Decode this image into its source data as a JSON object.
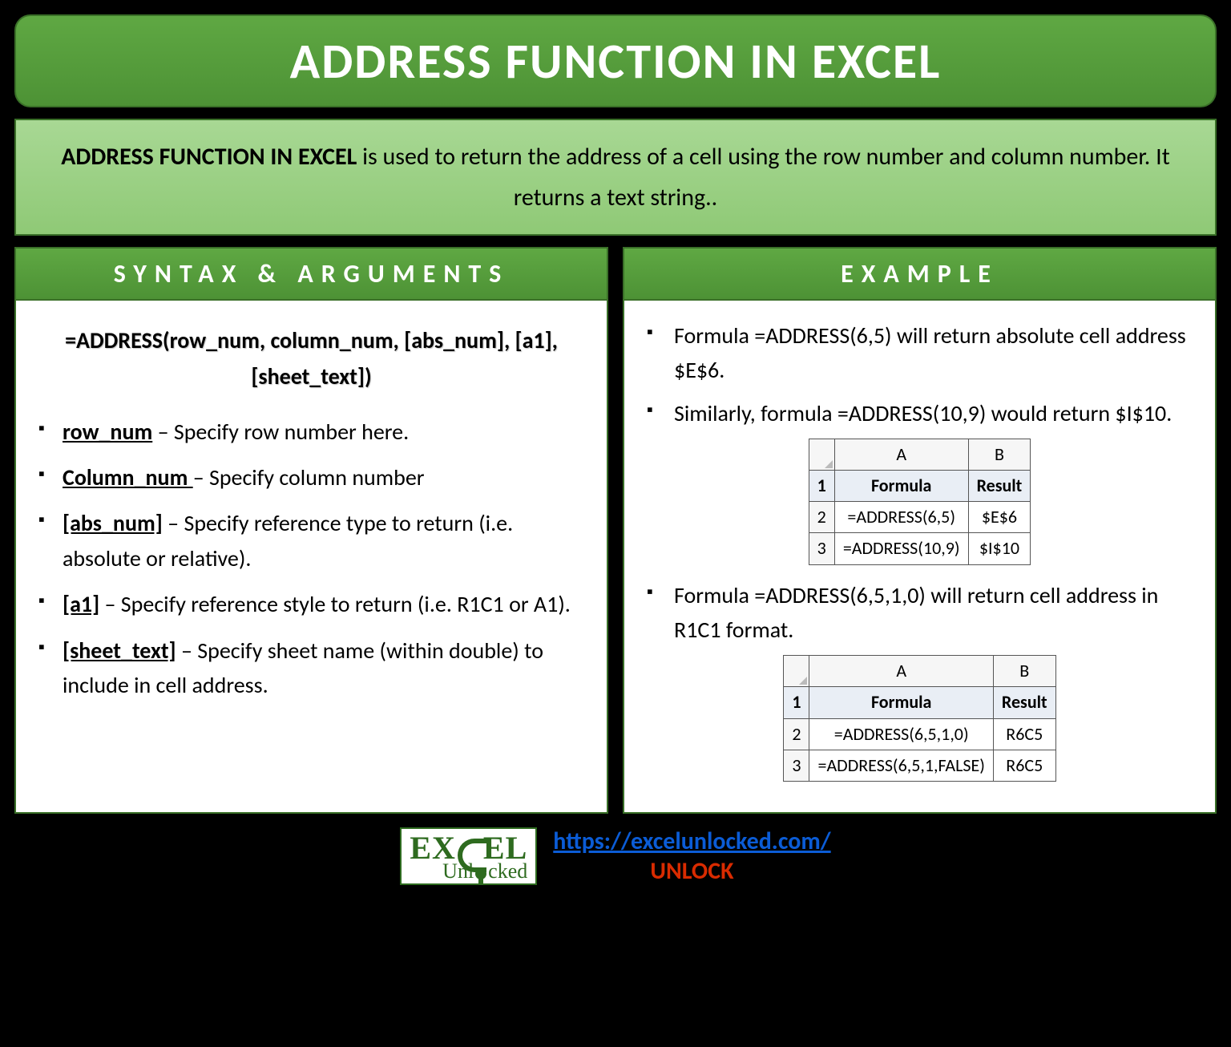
{
  "title": "ADDRESS FUNCTION IN EXCEL",
  "description": {
    "strong": "ADDRESS FUNCTION IN EXCEL",
    "rest": " is used to return the address of a cell using the row number and column number. It returns a text string.."
  },
  "left": {
    "header": "SYNTAX & ARGUMENTS",
    "formula": "=ADDRESS(row_num, column_num, [abs_num], [a1], [sheet_text])",
    "args": [
      {
        "name": "row_num",
        "desc": " – Specify row number here."
      },
      {
        "name": "Column_num ",
        "desc": "– Specify column number"
      },
      {
        "name": "[abs_num]",
        "desc": " – Specify reference type to return (i.e. absolute or relative)."
      },
      {
        "name": "[a1]",
        "desc": " – Specify reference style to return (i.e. R1C1 or A1)."
      },
      {
        "name": "[sheet_text]",
        "desc": " – Specify sheet name (within double) to include in cell address."
      }
    ]
  },
  "right": {
    "header": "EXAMPLE",
    "bullets": [
      "Formula =ADDRESS(6,5) will return absolute cell address $E$6.",
      "Similarly, formula =ADDRESS(10,9) would return $I$10."
    ],
    "table1": {
      "cols": [
        "A",
        "B"
      ],
      "header": [
        "Formula",
        "Result"
      ],
      "rows": [
        [
          "1"
        ],
        [
          "2",
          "=ADDRESS(6,5)",
          "$E$6"
        ],
        [
          "3",
          "=ADDRESS(10,9)",
          "$I$10"
        ]
      ]
    },
    "bullet3": "Formula =ADDRESS(6,5,1,0) will return cell address in R1C1 format.",
    "table2": {
      "cols": [
        "A",
        "B"
      ],
      "header": [
        "Formula",
        "Result"
      ],
      "rows": [
        [
          "1"
        ],
        [
          "2",
          "=ADDRESS(6,5,1,0)",
          "R6C5"
        ],
        [
          "3",
          "=ADDRESS(6,5,1,FALSE)",
          "R6C5"
        ]
      ]
    }
  },
  "footer": {
    "logo_top_1": "EX",
    "logo_top_2": "EL",
    "logo_bottom_1": "Unl",
    "logo_bottom_2": "cked",
    "url": "https://excelunlocked.com/",
    "unlock": "UNLOCK"
  }
}
